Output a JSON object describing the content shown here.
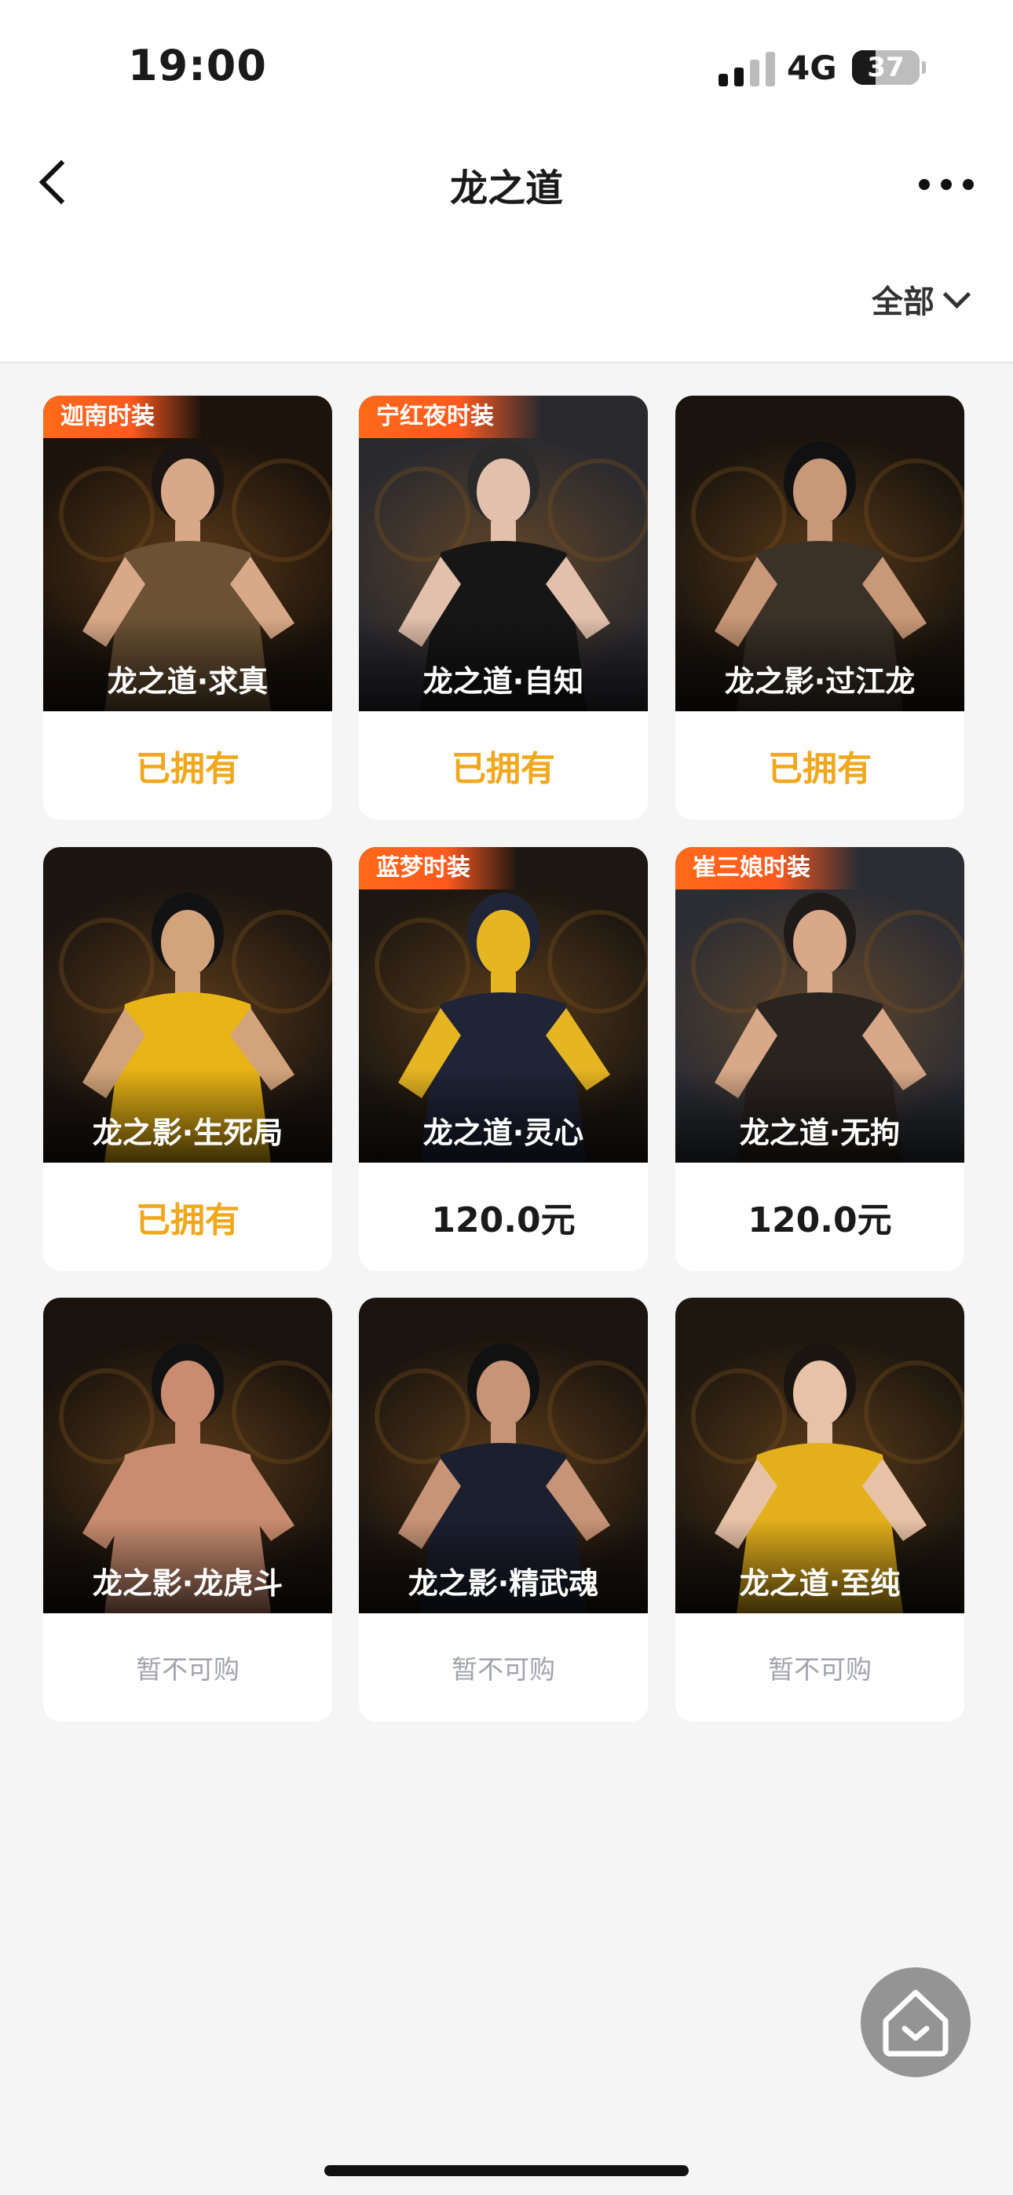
{
  "status": {
    "time": "19:00",
    "network": "4G",
    "battery": "37"
  },
  "header": {
    "title": "龙之道"
  },
  "filter": {
    "label": "全部"
  },
  "colors": {
    "owned": "#f0a81e",
    "tag": "#ff5a1f",
    "unavailable": "#a3a3ad"
  },
  "items": [
    {
      "tag": "迦南时装",
      "name": "龙之道·求真",
      "price": "已拥有",
      "state": "owned"
    },
    {
      "tag": "宁红夜时装",
      "name": "龙之道·自知",
      "price": "已拥有",
      "state": "owned"
    },
    {
      "tag": "",
      "name": "龙之影·过江龙",
      "price": "已拥有",
      "state": "owned"
    },
    {
      "tag": "",
      "name": "龙之影·生死局",
      "price": "已拥有",
      "state": "owned"
    },
    {
      "tag": "蓝梦时装",
      "name": "龙之道·灵心",
      "price": "120.0元",
      "state": "price"
    },
    {
      "tag": "崔三娘时装",
      "name": "龙之道·无拘",
      "price": "120.0元",
      "state": "price"
    },
    {
      "tag": "",
      "name": "龙之影·龙虎斗",
      "price": "暂不可购",
      "state": "unavailable"
    },
    {
      "tag": "",
      "name": "龙之影·精武魂",
      "price": "暂不可购",
      "state": "unavailable"
    },
    {
      "tag": "",
      "name": "龙之道·至纯",
      "price": "暂不可购",
      "state": "unavailable"
    }
  ],
  "icons": {
    "back": "chevron-left-icon",
    "more": "more-dots-icon",
    "filter": "chevron-down-icon",
    "home": "home-icon"
  }
}
